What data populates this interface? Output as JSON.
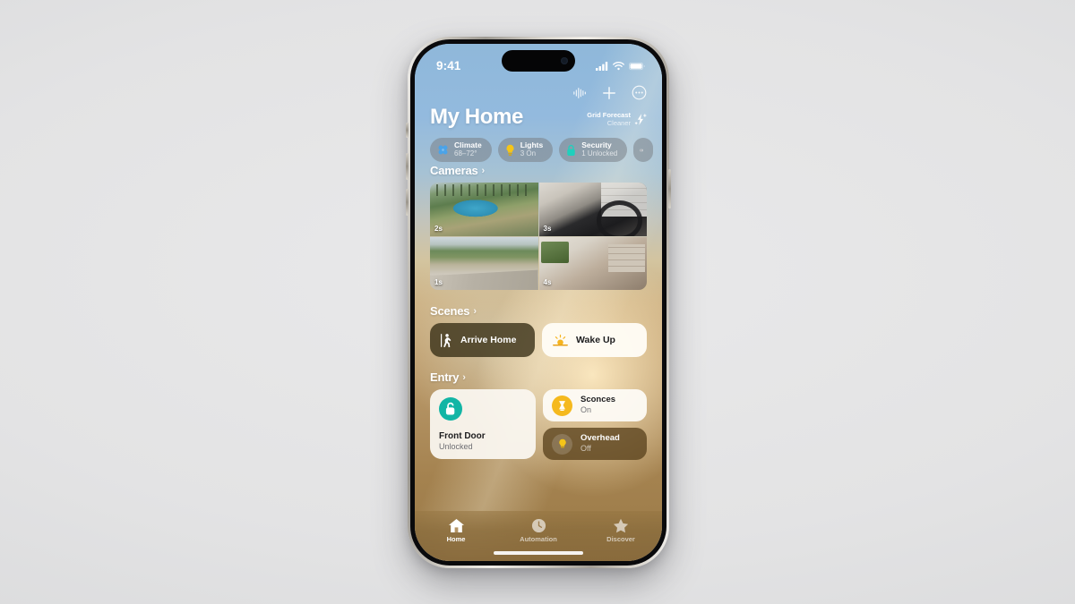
{
  "status_bar": {
    "time": "9:41",
    "icons": [
      "cellular-signal-icon",
      "wifi-icon",
      "battery-icon"
    ]
  },
  "top_actions": [
    {
      "name": "audio-waveform-button",
      "icon": "waveform-icon"
    },
    {
      "name": "add-accessory-button",
      "icon": "plus-icon"
    },
    {
      "name": "more-options-button",
      "icon": "ellipsis-circle-icon"
    }
  ],
  "header": {
    "title": "My Home",
    "grid_forecast": {
      "title": "Grid Forecast",
      "subtitle": "Cleaner",
      "icon": "clean-energy-bolt-icon"
    }
  },
  "category_pills": [
    {
      "title": "Climate",
      "subtitle": "68–72°",
      "icon": "climate-fan-icon",
      "color": "#4aa3e8"
    },
    {
      "title": "Lights",
      "subtitle": "3 On",
      "icon": "lightbulb-icon",
      "color": "#f5c518"
    },
    {
      "title": "Security",
      "subtitle": "1 Unlocked",
      "icon": "lock-icon",
      "color": "#1fd0bd"
    },
    {
      "title": "",
      "subtitle": "",
      "icon": "speaker-icon",
      "color": "#cfd2d6"
    }
  ],
  "sections": {
    "cameras": {
      "title": "Cameras",
      "chevron": "›",
      "tiles": [
        {
          "name": "camera-pool",
          "badge": "2s"
        },
        {
          "name": "camera-gym",
          "badge": "3s"
        },
        {
          "name": "camera-driveway",
          "badge": "1s"
        },
        {
          "name": "camera-living-room",
          "badge": "4s"
        }
      ]
    },
    "scenes": {
      "title": "Scenes",
      "chevron": "›",
      "tiles": [
        {
          "name": "scene-arrive-home",
          "label": "Arrive Home",
          "icon": "walking-person-icon",
          "style": "dark"
        },
        {
          "name": "scene-wake-up",
          "label": "Wake Up",
          "icon": "sunrise-icon",
          "style": "light"
        }
      ]
    },
    "entry": {
      "title": "Entry",
      "chevron": "›",
      "front_door": {
        "name": "accessory-front-door",
        "title": "Front Door",
        "subtitle": "Unlocked",
        "icon": "unlocked-padlock-icon",
        "icon_color": "#12b5a5"
      },
      "accessories": [
        {
          "name": "accessory-sconces",
          "title": "Sconces",
          "subtitle": "On",
          "icon": "sconce-lamp-icon",
          "style": "light"
        },
        {
          "name": "accessory-overhead",
          "title": "Overhead",
          "subtitle": "Off",
          "icon": "lightbulb-icon",
          "style": "dark"
        }
      ]
    }
  },
  "tab_bar": [
    {
      "name": "tab-home",
      "label": "Home",
      "icon": "house-icon",
      "active": true
    },
    {
      "name": "tab-automation",
      "label": "Automation",
      "icon": "clock-icon",
      "active": false
    },
    {
      "name": "tab-discover",
      "label": "Discover",
      "icon": "star-icon",
      "active": false
    }
  ]
}
